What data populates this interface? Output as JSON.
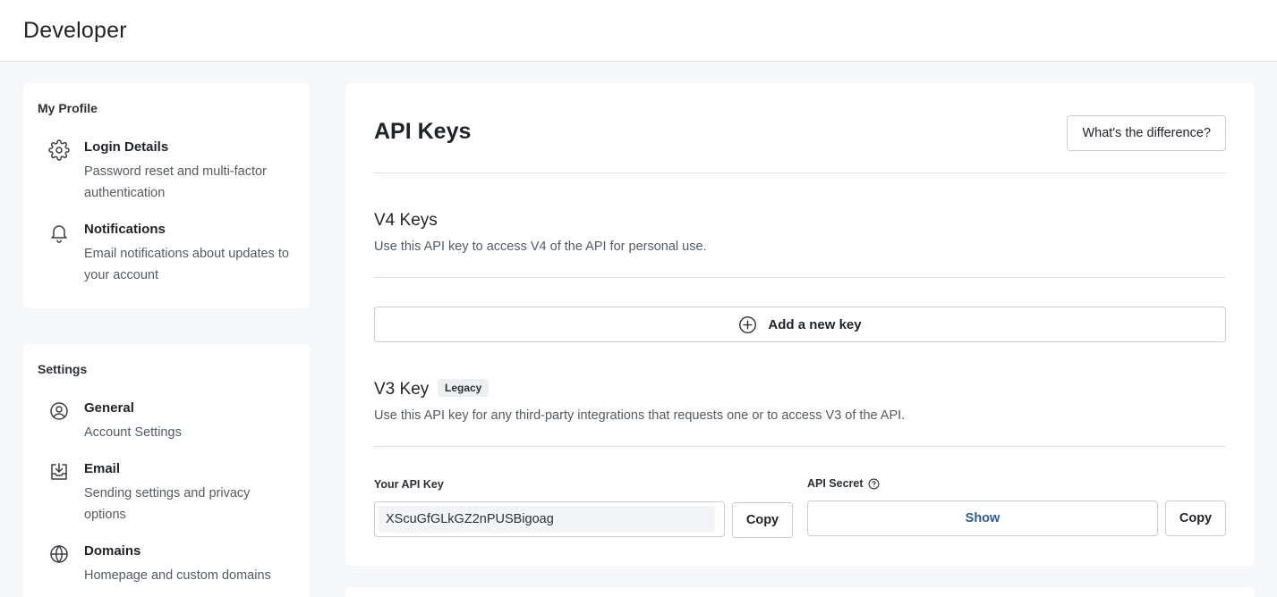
{
  "header": {
    "title": "Developer"
  },
  "sidebar": {
    "profile": {
      "heading": "My Profile",
      "items": [
        {
          "icon": "gear-icon",
          "title": "Login Details",
          "desc": "Password reset and multi-factor authentication"
        },
        {
          "icon": "bell-icon",
          "title": "Notifications",
          "desc": "Email notifications about updates to your account"
        }
      ]
    },
    "settings": {
      "heading": "Settings",
      "items": [
        {
          "icon": "user-circle-icon",
          "title": "General",
          "desc": "Account Settings"
        },
        {
          "icon": "inbox-download-icon",
          "title": "Email",
          "desc": "Sending settings and privacy options"
        },
        {
          "icon": "globe-icon",
          "title": "Domains",
          "desc": "Homepage and custom domains"
        }
      ]
    }
  },
  "main": {
    "title": "API Keys",
    "diff_button": "What's the difference?",
    "v4": {
      "title": "V4 Keys",
      "desc": "Use this API key to access V4 of the API for personal use.",
      "add_button": "Add a new key"
    },
    "v3": {
      "title": "V3 Key",
      "badge": "Legacy",
      "desc": "Use this API key for any third-party integrations that requests one or to access V3 of the API.",
      "api_key_label": "Your API Key",
      "api_key_value": "XScuGfGLkGZ2nPUSBigoag",
      "copy_label": "Copy",
      "secret_label": "API Secret",
      "show_label": "Show",
      "copy_secret_label": "Copy"
    }
  }
}
